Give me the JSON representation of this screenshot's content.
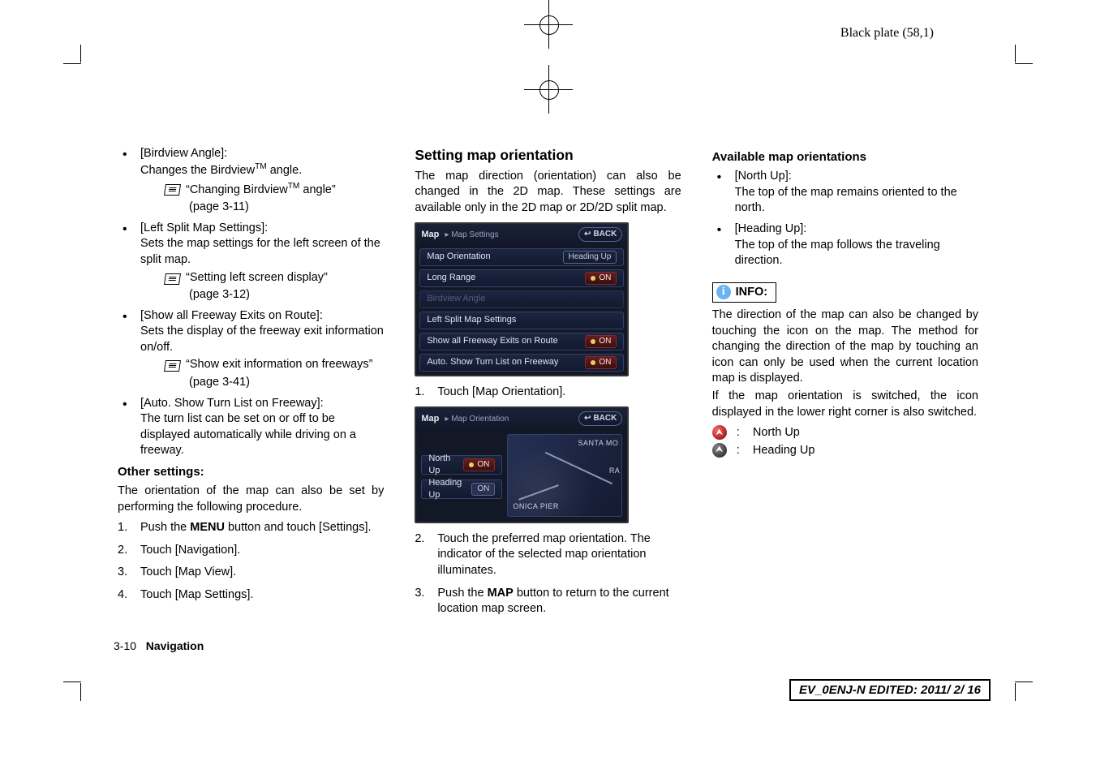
{
  "meta": {
    "plate_text": "Black plate (58,1)",
    "footer_page": "3-10",
    "footer_section": "Navigation",
    "edit_stamp": "EV_0ENJ-N EDITED:  2011/ 2/ 16"
  },
  "col1": {
    "bullets": [
      {
        "title": "[Birdview Angle]:",
        "desc": "Changes the Birdview",
        "desc_suffix": " angle.",
        "ref": "“Changing Birdview",
        "ref_suffix": " angle”",
        "ref_page": "(page 3-11)"
      },
      {
        "title": "[Left Split Map Settings]:",
        "desc": "Sets the map settings for the left screen of the split map.",
        "ref": "“Setting left screen display”",
        "ref_page": "(page 3-12)"
      },
      {
        "title": "[Show all Freeway Exits on Route]:",
        "desc": "Sets the display of the freeway exit information on/off.",
        "ref": "“Show exit information on freeways”",
        "ref_page": "(page 3-41)"
      },
      {
        "title": "[Auto. Show Turn List on Freeway]:",
        "desc": "The turn list can be set on or off to be displayed automatically while driving on a freeway."
      }
    ],
    "other_heading": "Other settings:",
    "other_desc": "The orientation of the map can also be set by performing the following procedure.",
    "steps": [
      {
        "n": "1.",
        "pre": "Push the ",
        "bold": "MENU",
        "post": " button and touch [Settings]."
      },
      {
        "n": "2.",
        "text": "Touch [Navigation]."
      },
      {
        "n": "3.",
        "text": "Touch [Map View]."
      },
      {
        "n": "4.",
        "text": "Touch [Map Settings]."
      }
    ]
  },
  "col2": {
    "heading": "Setting map orientation",
    "intro": "The map direction (orientation) can also be changed in the 2D map. These settings are available only in the 2D map or 2D/2D split map.",
    "shot1": {
      "title": "Map",
      "crumb": "Map Settings",
      "back": "BACK",
      "rows": [
        {
          "label": "Map Orientation",
          "value": "Heading Up",
          "style": "val"
        },
        {
          "label": "Long Range",
          "value": "ON",
          "style": "red",
          "dot": true
        },
        {
          "label": "Birdview Angle",
          "disabled": true
        },
        {
          "label": "Left Split Map Settings"
        },
        {
          "label": "Show all Freeway Exits on Route",
          "value": "ON",
          "style": "red",
          "dot": true
        },
        {
          "label": "Auto. Show Turn List on Freeway",
          "value": "ON",
          "style": "red",
          "dot": true
        }
      ]
    },
    "step1": {
      "n": "1.",
      "text": "Touch [Map Orientation]."
    },
    "shot2": {
      "title": "Map",
      "crumb": "Map Orientation",
      "back": "BACK",
      "options": [
        {
          "label": "North Up",
          "value": "ON",
          "style": "red",
          "dot": true
        },
        {
          "label": "Heading Up",
          "value": "ON",
          "style": "grey"
        }
      ],
      "map_labels": {
        "tr": "SANTA MO",
        "bl": "ONICA PIER",
        "r": "RA"
      }
    },
    "step2": {
      "n": "2.",
      "text": "Touch the preferred map orientation. The indicator of the selected map orientation illuminates."
    },
    "step3": {
      "n": "3.",
      "pre": "Push the ",
      "bold": "MAP",
      "post": " button to return to the current location map screen."
    }
  },
  "col3": {
    "heading": "Available map orientations",
    "bullets": [
      {
        "title": "[North Up]:",
        "desc": "The top of the map remains oriented to the north."
      },
      {
        "title": "[Heading Up]:",
        "desc": "The top of the map follows the traveling direction."
      }
    ],
    "info_label": "INFO:",
    "info_text": [
      "The direction of the map can also be changed by touching the icon on the map. The method for changing the direction of the map by touching an icon can only be used when the current location map is displayed.",
      "If the map orientation is switched, the icon displayed in the lower right corner is also switched."
    ],
    "icons": [
      {
        "label": "North Up",
        "cls": "red"
      },
      {
        "label": "Heading Up",
        "cls": "grey"
      }
    ]
  }
}
